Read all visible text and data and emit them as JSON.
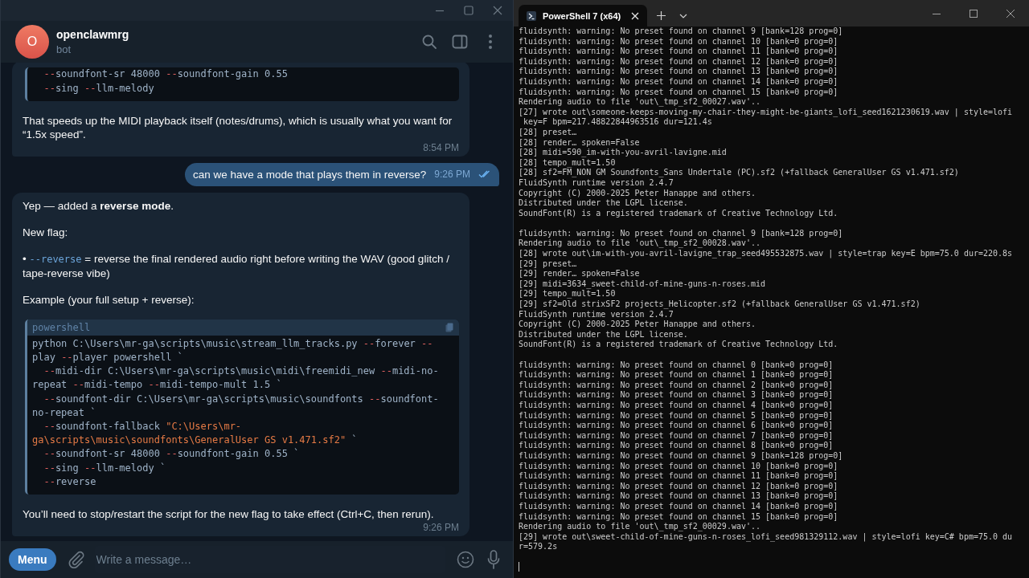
{
  "telegram": {
    "chat": {
      "avatar_letter": "O",
      "name": "openclawmrg",
      "status": "bot"
    },
    "messages": [
      {
        "kind": "incoming",
        "time": "8:54 PM",
        "blocks": [
          {
            "kind": "code",
            "lines": [
              {
                "indent": true,
                "segments": [
                  {
                    "kind": "flag",
                    "text": "--"
                  },
                  {
                    "kind": "plain",
                    "text": "soundfont-sr 48000 "
                  },
                  {
                    "kind": "flag",
                    "text": "--"
                  },
                  {
                    "kind": "plain",
                    "text": "soundfont-gain 0.55"
                  }
                ]
              },
              {
                "indent": true,
                "segments": [
                  {
                    "kind": "flag",
                    "text": "--"
                  },
                  {
                    "kind": "plain",
                    "text": "sing "
                  },
                  {
                    "kind": "flag",
                    "text": "--"
                  },
                  {
                    "kind": "plain",
                    "text": "llm-melody"
                  }
                ]
              }
            ]
          },
          {
            "kind": "paragraph",
            "segments": [
              {
                "kind": "text",
                "text": "That speeds up the MIDI playback itself (notes/drums), which is usually what you want for “1.5x speed”."
              }
            ]
          }
        ]
      },
      {
        "kind": "outgoing",
        "time": "9:26 PM",
        "read": true,
        "text": "can we have a mode that plays them in reverse?"
      },
      {
        "kind": "incoming",
        "time": "9:26 PM",
        "blocks": [
          {
            "kind": "paragraph",
            "segments": [
              {
                "kind": "text",
                "text": "Yep — added a "
              },
              {
                "kind": "bold",
                "text": "reverse mode"
              },
              {
                "kind": "text",
                "text": "."
              }
            ]
          },
          {
            "kind": "paragraph",
            "segments": [
              {
                "kind": "text",
                "text": "New flag:"
              }
            ]
          },
          {
            "kind": "paragraph",
            "segments": [
              {
                "kind": "text",
                "text": "• "
              },
              {
                "kind": "code",
                "text": "--reverse"
              },
              {
                "kind": "text",
                "text": " = reverse the final rendered audio right before writing the WAV (good glitch / tape-reverse vibe)"
              }
            ]
          },
          {
            "kind": "paragraph",
            "segments": [
              {
                "kind": "text",
                "text": "Example (your full setup + reverse):"
              }
            ]
          },
          {
            "kind": "code",
            "language": "powershell",
            "lines": [
              {
                "indent": false,
                "segments": [
                  {
                    "kind": "plain",
                    "text": "python C:\\Users\\mr-ga\\scripts\\music\\stream_llm_tracks.py "
                  },
                  {
                    "kind": "flag",
                    "text": "--"
                  },
                  {
                    "kind": "plain",
                    "text": "forever "
                  },
                  {
                    "kind": "flag",
                    "text": "--"
                  }
                ]
              },
              {
                "indent": false,
                "segments": [
                  {
                    "kind": "plain",
                    "text": "play "
                  },
                  {
                    "kind": "flag",
                    "text": "--"
                  },
                  {
                    "kind": "plain",
                    "text": "player powershell `"
                  }
                ]
              },
              {
                "indent": true,
                "segments": [
                  {
                    "kind": "flag",
                    "text": "--"
                  },
                  {
                    "kind": "plain",
                    "text": "midi-dir C:\\Users\\mr-ga\\scripts\\music\\midi\\freemidi_new "
                  },
                  {
                    "kind": "flag",
                    "text": "--"
                  },
                  {
                    "kind": "plain",
                    "text": "midi-no-"
                  }
                ]
              },
              {
                "indent": false,
                "segments": [
                  {
                    "kind": "plain",
                    "text": "repeat "
                  },
                  {
                    "kind": "flag",
                    "text": "--"
                  },
                  {
                    "kind": "plain",
                    "text": "midi-tempo "
                  },
                  {
                    "kind": "flag",
                    "text": "--"
                  },
                  {
                    "kind": "plain",
                    "text": "midi-tempo-mult 1.5 `"
                  }
                ]
              },
              {
                "indent": true,
                "segments": [
                  {
                    "kind": "flag",
                    "text": "--"
                  },
                  {
                    "kind": "plain",
                    "text": "soundfont-dir C:\\Users\\mr-ga\\scripts\\music\\soundfonts "
                  },
                  {
                    "kind": "flag",
                    "text": "--"
                  },
                  {
                    "kind": "plain",
                    "text": "soundfont-"
                  }
                ]
              },
              {
                "indent": false,
                "segments": [
                  {
                    "kind": "plain",
                    "text": "no-repeat `"
                  }
                ]
              },
              {
                "indent": true,
                "segments": [
                  {
                    "kind": "flag",
                    "text": "--"
                  },
                  {
                    "kind": "plain",
                    "text": "soundfont-fallback "
                  },
                  {
                    "kind": "string",
                    "text": "\"C:\\Users\\mr-"
                  }
                ]
              },
              {
                "indent": false,
                "segments": [
                  {
                    "kind": "string",
                    "text": "ga\\scripts\\music\\soundfonts\\GeneralUser GS v1.471.sf2\""
                  },
                  {
                    "kind": "plain",
                    "text": " `"
                  }
                ]
              },
              {
                "indent": true,
                "segments": [
                  {
                    "kind": "flag",
                    "text": "--"
                  },
                  {
                    "kind": "plain",
                    "text": "soundfont-sr 48000 "
                  },
                  {
                    "kind": "flag",
                    "text": "--"
                  },
                  {
                    "kind": "plain",
                    "text": "soundfont-gain 0.55 `"
                  }
                ]
              },
              {
                "indent": true,
                "segments": [
                  {
                    "kind": "flag",
                    "text": "--"
                  },
                  {
                    "kind": "plain",
                    "text": "sing "
                  },
                  {
                    "kind": "flag",
                    "text": "--"
                  },
                  {
                    "kind": "plain",
                    "text": "llm-melody `"
                  }
                ]
              },
              {
                "indent": true,
                "segments": [
                  {
                    "kind": "flag",
                    "text": "--"
                  },
                  {
                    "kind": "plain",
                    "text": "reverse"
                  }
                ]
              }
            ]
          },
          {
            "kind": "paragraph",
            "segments": [
              {
                "kind": "text",
                "text": "You’ll need to stop/restart the script for the new flag to take effect (Ctrl+C, then rerun)."
              }
            ]
          }
        ]
      }
    ],
    "composer": {
      "menu": "Menu",
      "placeholder": "Write a message…"
    }
  },
  "terminal": {
    "tab": {
      "title": "PowerShell 7 (x64)",
      "selected": true
    },
    "blocks": [
      [
        "fluidsynth: warning: No preset found on channel 9 [bank=128 prog=0]",
        "fluidsynth: warning: No preset found on channel 10 [bank=0 prog=0]",
        "fluidsynth: warning: No preset found on channel 11 [bank=0 prog=0]",
        "fluidsynth: warning: No preset found on channel 12 [bank=0 prog=0]",
        "fluidsynth: warning: No preset found on channel 13 [bank=0 prog=0]",
        "fluidsynth: warning: No preset found on channel 14 [bank=0 prog=0]",
        "fluidsynth: warning: No preset found on channel 15 [bank=0 prog=0]",
        "Rendering audio to file 'out\\_tmp_sf2_00027.wav'..",
        "[27] wrote out\\someone-keeps-moving-my-chair-they-might-be-giants_lofi_seed1621230619.wav | style=lofi",
        " key=F bpm=217.48822844963516 dur=121.4s",
        "[28] preset…",
        "[28] render… spoken=False",
        "[28] midi=590_im-with-you-avril-lavigne.mid",
        "[28] tempo_mult=1.50",
        "[28] sf2=FM_NON GM Soundfonts_Sans Undertale (PC).sf2 (+fallback GeneralUser GS v1.471.sf2)",
        "FluidSynth runtime version 2.4.7",
        "Copyright (C) 2000-2025 Peter Hanappe and others.",
        "Distributed under the LGPL license.",
        "SoundFont(R) is a registered trademark of Creative Technology Ltd."
      ],
      [
        "fluidsynth: warning: No preset found on channel 9 [bank=128 prog=0]",
        "Rendering audio to file 'out\\_tmp_sf2_00028.wav'..",
        "[28] wrote out\\im-with-you-avril-lavigne_trap_seed495532875.wav | style=trap key=E bpm=75.0 dur=220.8s",
        "[29] preset…",
        "[29] render… spoken=False",
        "[29] midi=3634_sweet-child-of-mine-guns-n-roses.mid",
        "[29] tempo_mult=1.50",
        "[29] sf2=Old strixSF2 projects_Helicopter.sf2 (+fallback GeneralUser GS v1.471.sf2)",
        "FluidSynth runtime version 2.4.7",
        "Copyright (C) 2000-2025 Peter Hanappe and others.",
        "Distributed under the LGPL license.",
        "SoundFont(R) is a registered trademark of Creative Technology Ltd."
      ],
      [
        "fluidsynth: warning: No preset found on channel 0 [bank=0 prog=0]",
        "fluidsynth: warning: No preset found on channel 1 [bank=0 prog=0]",
        "fluidsynth: warning: No preset found on channel 2 [bank=0 prog=0]",
        "fluidsynth: warning: No preset found on channel 3 [bank=0 prog=0]",
        "fluidsynth: warning: No preset found on channel 4 [bank=0 prog=0]",
        "fluidsynth: warning: No preset found on channel 5 [bank=0 prog=0]",
        "fluidsynth: warning: No preset found on channel 6 [bank=0 prog=0]",
        "fluidsynth: warning: No preset found on channel 7 [bank=0 prog=0]",
        "fluidsynth: warning: No preset found on channel 8 [bank=0 prog=0]",
        "fluidsynth: warning: No preset found on channel 9 [bank=128 prog=0]",
        "fluidsynth: warning: No preset found on channel 10 [bank=0 prog=0]",
        "fluidsynth: warning: No preset found on channel 11 [bank=0 prog=0]",
        "fluidsynth: warning: No preset found on channel 12 [bank=0 prog=0]",
        "fluidsynth: warning: No preset found on channel 13 [bank=0 prog=0]",
        "fluidsynth: warning: No preset found on channel 14 [bank=0 prog=0]",
        "fluidsynth: warning: No preset found on channel 15 [bank=0 prog=0]",
        "Rendering audio to file 'out\\_tmp_sf2_00029.wav'..",
        "[29] wrote out\\sweet-child-of-mine-guns-n-roses_lofi_seed981329112.wav | style=lofi key=C# bpm=75.0 du",
        "r=579.2s"
      ]
    ]
  }
}
